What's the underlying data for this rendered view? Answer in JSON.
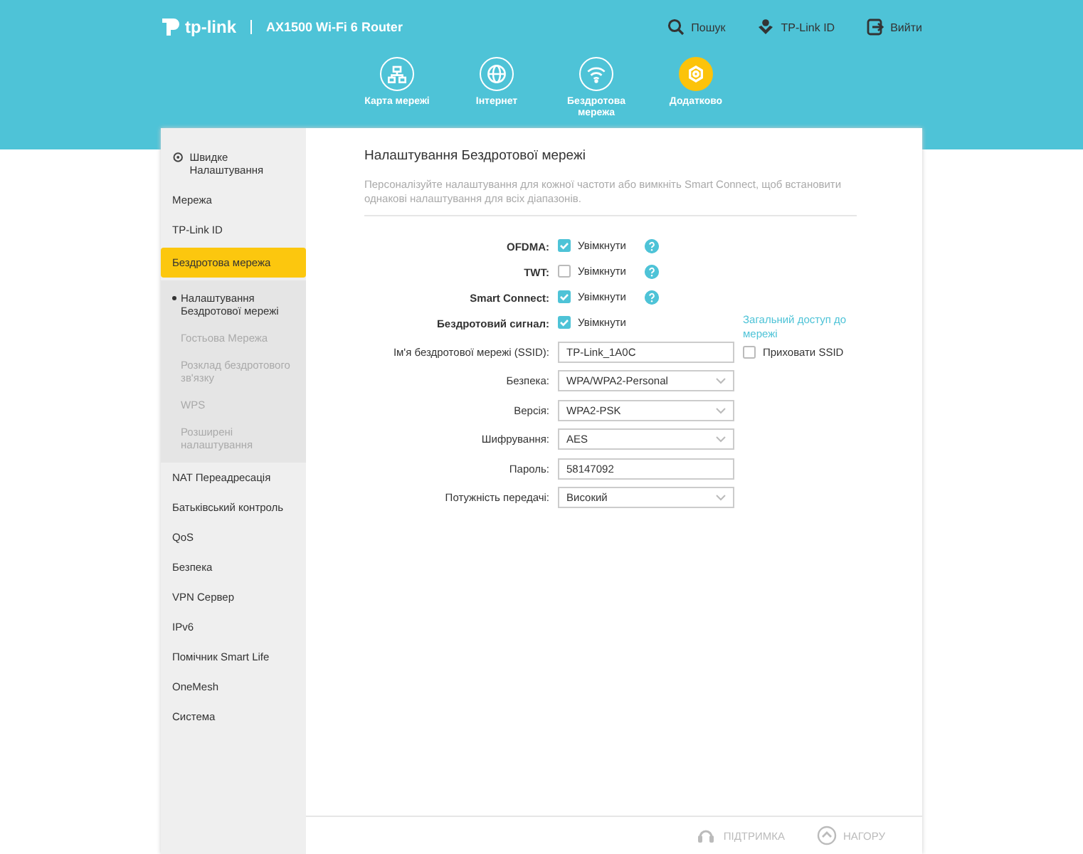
{
  "header": {
    "brand": "tp-link",
    "model": "AX1500 Wi-Fi 6 Router",
    "actions": [
      {
        "kind": "search",
        "label": "Пошук"
      },
      {
        "kind": "id",
        "label": "TP-Link ID"
      },
      {
        "kind": "logout",
        "label": "Вийти"
      }
    ],
    "nav": [
      {
        "kind": "map",
        "label": "Карта мережі",
        "selected": false
      },
      {
        "kind": "globe",
        "label": "Інтернет",
        "selected": false
      },
      {
        "kind": "wifi",
        "label": "Бездротова мережа",
        "selected": false
      },
      {
        "kind": "gear",
        "label": "Додатково",
        "selected": true
      }
    ]
  },
  "sidebar": {
    "items": [
      {
        "label": "Швидке Налаштування",
        "icon": true,
        "selected": false
      },
      {
        "label": "Мережа",
        "selected": false
      },
      {
        "label": "TP-Link ID",
        "selected": false
      },
      {
        "label": "Бездротова мережа",
        "selected": true,
        "children": [
          {
            "label": "Налаштування Бездротової мережі",
            "selected": true
          },
          {
            "label": "Гостьова Мережа",
            "selected": false
          },
          {
            "label": "Розклад бездротового зв'язку",
            "selected": false
          },
          {
            "label": "WPS",
            "selected": false
          },
          {
            "label": "Розширені налаштування",
            "selected": false
          }
        ]
      },
      {
        "label": "NAT Переадресація",
        "selected": false
      },
      {
        "label": "Батьківський контроль",
        "selected": false
      },
      {
        "label": "QoS",
        "selected": false
      },
      {
        "label": "Безпека",
        "selected": false
      },
      {
        "label": "VPN Сервер",
        "selected": false
      },
      {
        "label": "IPv6",
        "selected": false
      },
      {
        "label": "Помічник Smart Life",
        "selected": false
      },
      {
        "label": "OneMesh",
        "selected": false
      },
      {
        "label": "Система",
        "selected": false
      }
    ]
  },
  "content": {
    "title": "Налаштування Бездротової мережі",
    "description": "Персоналізуйте налаштування для кожної частоти або вимкніть Smart Connect, щоб встановити однакові налаштування для всіх діапазонів.",
    "fields": [
      {
        "kind": "checkbox",
        "label": "OFDMA:",
        "option": "Увімкнути",
        "checked": true,
        "help": true
      },
      {
        "kind": "checkbox",
        "label": "TWT:",
        "option": "Увімкнути",
        "checked": false,
        "help": true
      },
      {
        "kind": "checkbox",
        "label": "Smart Connect:",
        "option": "Увімкнути",
        "checked": true,
        "help": true
      },
      {
        "kind": "checkbox",
        "label": "Бездротовий сигнал:",
        "option": "Увімкнути",
        "checked": true,
        "help": false,
        "link": "Загальний доступ до мережі"
      },
      {
        "kind": "text",
        "label": "Ім'я бездротової мережі (SSID):",
        "value": "TP-Link_1A0C",
        "extra": {
          "label": "Приховати SSID",
          "checked": false
        }
      },
      {
        "kind": "select",
        "label": "Безпека:",
        "value": "WPA/WPA2-Personal"
      },
      {
        "kind": "select",
        "label": "Версія:",
        "value": "WPA2-PSK"
      },
      {
        "kind": "select",
        "label": "Шифрування:",
        "value": "AES"
      },
      {
        "kind": "text",
        "label": "Пароль:",
        "value": "58147092"
      },
      {
        "kind": "select",
        "label": "Потужність передачі:",
        "value": "Високий"
      }
    ]
  },
  "footer": [
    {
      "kind": "support",
      "label": "ПІДТРИМКА"
    },
    {
      "kind": "top",
      "label": "НАГОРУ"
    }
  ]
}
